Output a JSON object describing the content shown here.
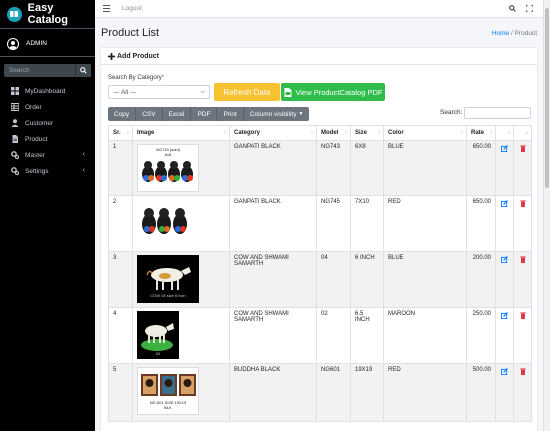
{
  "sidebar": {
    "brand": "Easy Catalog",
    "user": "ADMIN",
    "search_placeholder": "Search",
    "items": [
      {
        "label": "MyDashboard",
        "icon": "dashboard-icon"
      },
      {
        "label": "Order",
        "icon": "table-icon"
      },
      {
        "label": "Customer",
        "icon": "user-icon"
      },
      {
        "label": "Product",
        "icon": "file-icon"
      },
      {
        "label": "Master",
        "icon": "gears-icon",
        "chevron": "‹"
      },
      {
        "label": "Settings",
        "icon": "gears-icon",
        "chevron": "‹"
      }
    ]
  },
  "topbar": {
    "logout": "Logout"
  },
  "page": {
    "title": "Product List",
    "breadcrumb_home": "Home",
    "breadcrumb_sep": "/",
    "breadcrumb_current": "Product"
  },
  "card": {
    "add_product": "Add Product",
    "filter_label": "Search By Category",
    "filter_value": "--- All ---",
    "refresh_label": "Refresh Data",
    "pdf_label": "View ProductCatalog PDF",
    "export_buttons": [
      "Copy",
      "CSV",
      "Excel",
      "PDF",
      "Print",
      "Column visibility"
    ],
    "search_label": "Search:"
  },
  "table": {
    "headers": [
      "Sr.",
      "Image",
      "Category",
      "Model",
      "Size",
      "Color",
      "Rate",
      "",
      ""
    ],
    "rows": [
      {
        "sr": "1",
        "category": "GANPATI BLACK",
        "model": "NG743",
        "size": "6X8",
        "color": "BLUE",
        "rate": "650.00",
        "image_caption": "NG743 (sold)\n6x8"
      },
      {
        "sr": "2",
        "category": "GANPATI BLACK",
        "model": "NG745",
        "size": "7X10",
        "color": "RED",
        "rate": "650.00",
        "image_caption": ""
      },
      {
        "sr": "3",
        "category": "COW AND SHWAMI SAMARTH",
        "model": "04",
        "size": "6 INCH",
        "color": "BLUE",
        "rate": "200.00",
        "image_caption": "COW 04 size 6 inch"
      },
      {
        "sr": "4",
        "category": "COW AND SHWAMI SAMARTH",
        "model": "02",
        "size": "6.5 INCH",
        "color": "MAROON",
        "rate": "250.00",
        "image_caption": "02"
      },
      {
        "sr": "5",
        "category": "BUDDHA BLACK",
        "model": "NG601",
        "size": "19X19",
        "color": "RED",
        "rate": "500.00",
        "image_caption": "NG 601 SIZE 19X19\nBLK"
      }
    ]
  },
  "colors": {
    "sidebar_bg": "#000000",
    "refresh_btn": "#f7c12f",
    "pdf_btn": "#2ebd4a",
    "export_btn": "#6c757d",
    "edit_icon": "#007bff",
    "delete_icon": "#dc3545"
  }
}
